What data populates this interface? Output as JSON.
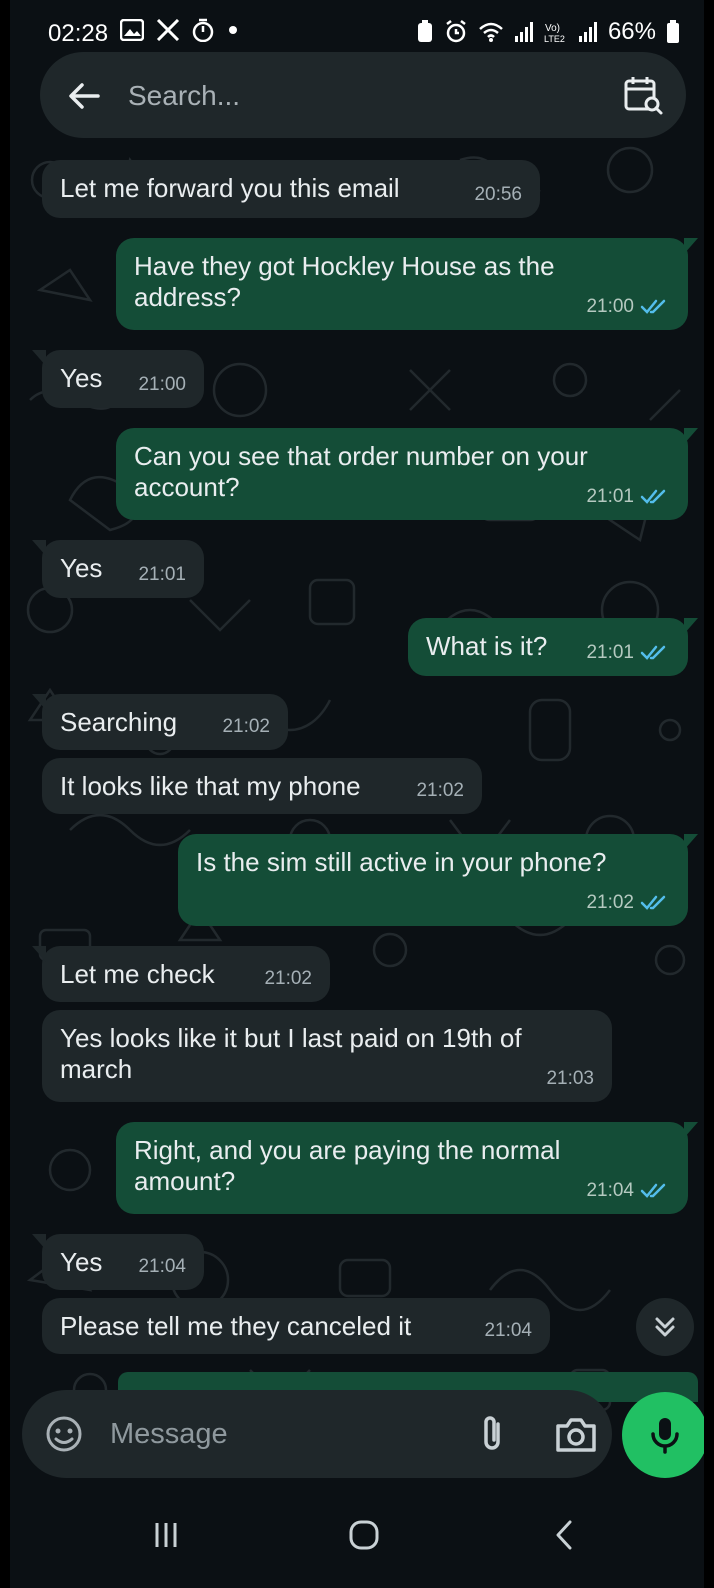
{
  "status_bar": {
    "time": "02:28",
    "battery": "66%",
    "left_icons": [
      "gallery-icon",
      "x-icon",
      "timer-icon",
      "dot-icon"
    ],
    "right_icons": [
      "battery-saver-icon",
      "alarm-icon",
      "wifi-icon",
      "signal-icon",
      "volte-icon",
      "signal-icon",
      "battery-icon"
    ]
  },
  "search": {
    "placeholder": "Search..."
  },
  "messages": [
    {
      "dir": "in",
      "text": "Let me forward you this email",
      "time": "20:56"
    },
    {
      "dir": "out",
      "text": "Have they got Hockley House as the address?",
      "time": "21:00",
      "read": true
    },
    {
      "dir": "in",
      "text": "Yes",
      "time": "21:00"
    },
    {
      "dir": "out",
      "text": "Can you see that order number on your account?",
      "time": "21:01",
      "read": true
    },
    {
      "dir": "in",
      "text": "Yes",
      "time": "21:01"
    },
    {
      "dir": "out",
      "text": "What is it?",
      "time": "21:01",
      "read": true
    },
    {
      "dir": "in",
      "text": "Searching",
      "time": "21:02"
    },
    {
      "dir": "in",
      "text": "It looks like that my phone",
      "time": "21:02"
    },
    {
      "dir": "out",
      "text": "Is the sim still active in your  phone?",
      "time": "21:02",
      "read": true
    },
    {
      "dir": "in",
      "text": "Let me check",
      "time": "21:02"
    },
    {
      "dir": "in",
      "text": "Yes looks like it but I last paid on 19th of march",
      "time": "21:03"
    },
    {
      "dir": "out",
      "text": "Right, and you are paying the normal amount?",
      "time": "21:04",
      "read": true
    },
    {
      "dir": "in",
      "text": "Yes",
      "time": "21:04"
    },
    {
      "dir": "in",
      "text": "Please tell me they canceled it",
      "time": "21:04"
    }
  ],
  "composer": {
    "placeholder": "Message"
  },
  "colors": {
    "background": "#0b1014",
    "incoming_bubble": "#1f272a",
    "outgoing_bubble": "#144d37",
    "mic_button": "#21c063",
    "read_ticks": "#53bdeb"
  }
}
